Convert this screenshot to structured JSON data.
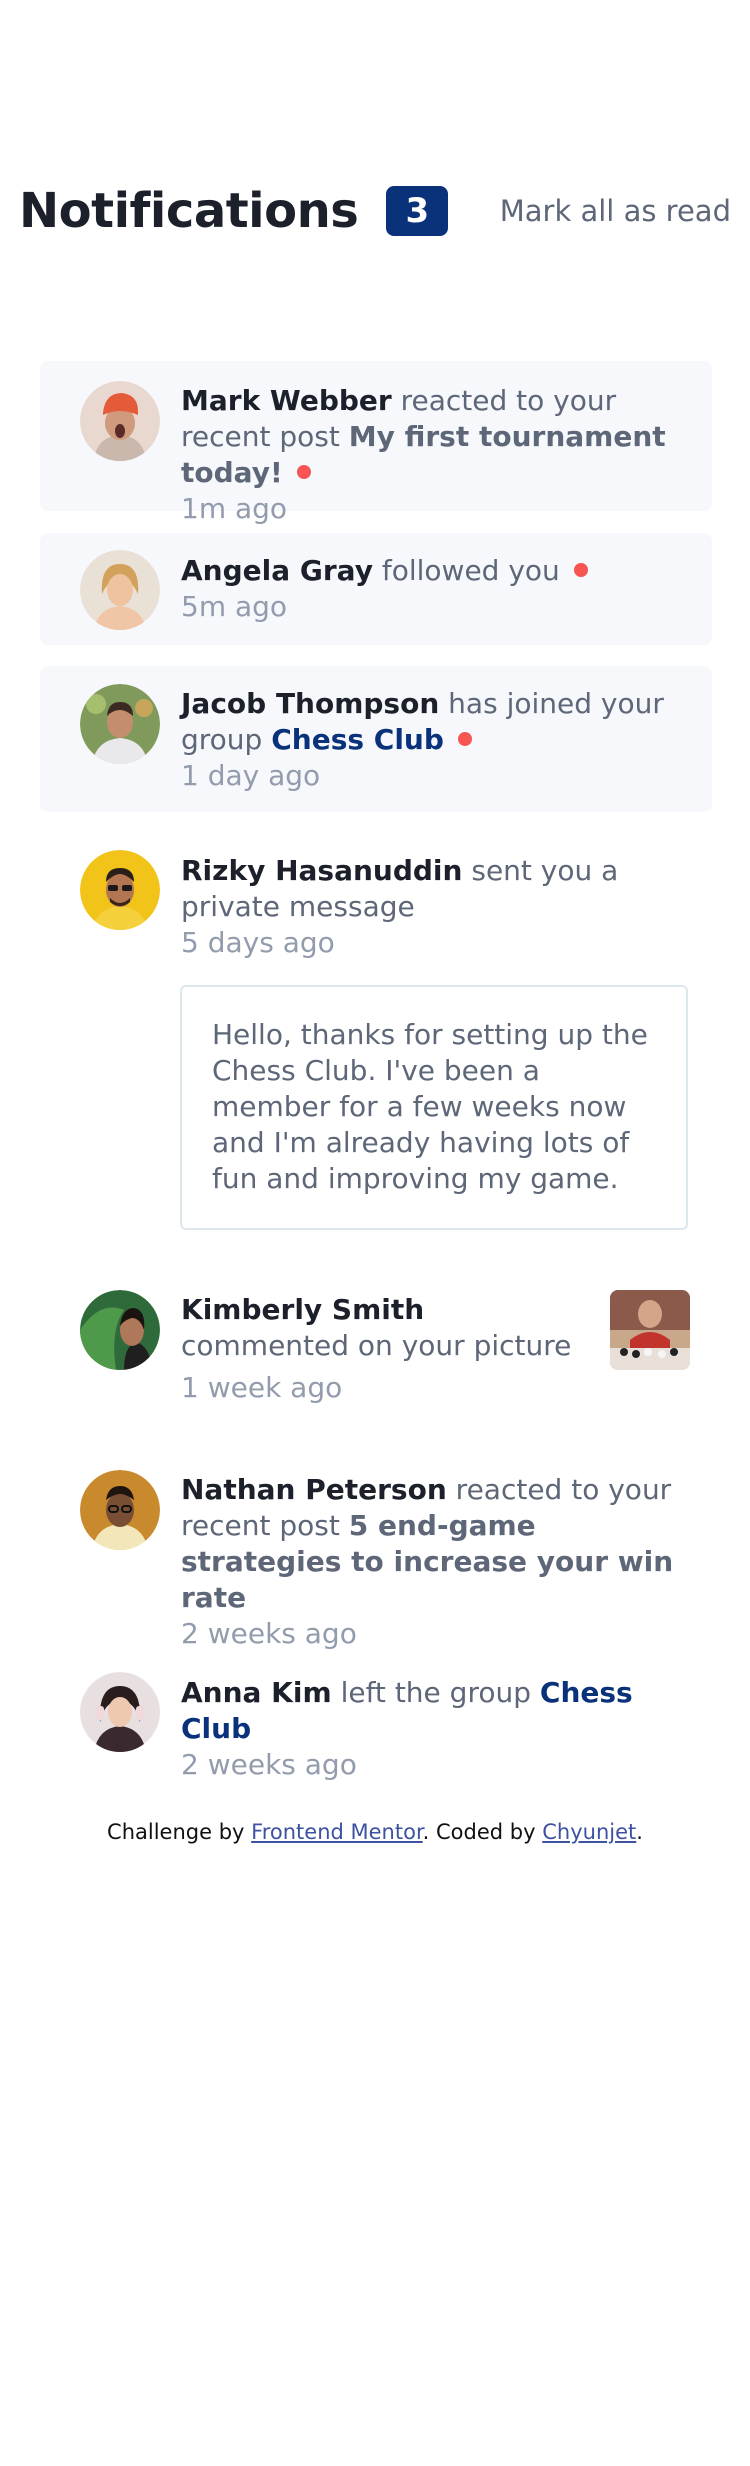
{
  "header": {
    "title": "Notifications",
    "unread_count": "3",
    "mark_all_label": "Mark all as read"
  },
  "notifications": [
    {
      "name": "Mark Webber",
      "action": "reacted to your recent post",
      "target": "My first tournament today!",
      "time": "1m ago",
      "unread": true
    },
    {
      "name": "Angela Gray",
      "action": "followed you",
      "time": "5m ago",
      "unread": true
    },
    {
      "name": "Jacob Thompson",
      "action": "has joined your group",
      "target": "Chess Club",
      "time": "1 day ago",
      "unread": true
    },
    {
      "name": "Rizky Hasanuddin",
      "action": "sent you a private message",
      "time": "5 days ago",
      "message": "Hello, thanks for setting up the Chess Club. I've been a member for a few weeks now and I'm already having lots of fun and improving my game.",
      "unread": false
    },
    {
      "name": "Kimberly Smith",
      "action": "commented on your picture",
      "time": "1 week ago",
      "unread": false
    },
    {
      "name": "Nathan Peterson",
      "action": "reacted to your recent post",
      "target": "5 end-game strategies to increase your win rate",
      "time": "2 weeks ago",
      "unread": false
    },
    {
      "name": "Anna Kim",
      "action": "left the group",
      "target": "Chess Club",
      "time": "2 weeks ago",
      "unread": false
    }
  ],
  "footer": {
    "prefix": "Challenge by",
    "link1": "Frontend Mentor",
    "middle": ". Coded by",
    "link2": "Chyunjet",
    "suffix": "."
  },
  "colors": {
    "unread_bg": "#f6f8fc",
    "badge": "#0a327b",
    "dot": "#f65552",
    "heading": "#1c202b",
    "text": "#5e6778",
    "muted": "#939cad"
  }
}
